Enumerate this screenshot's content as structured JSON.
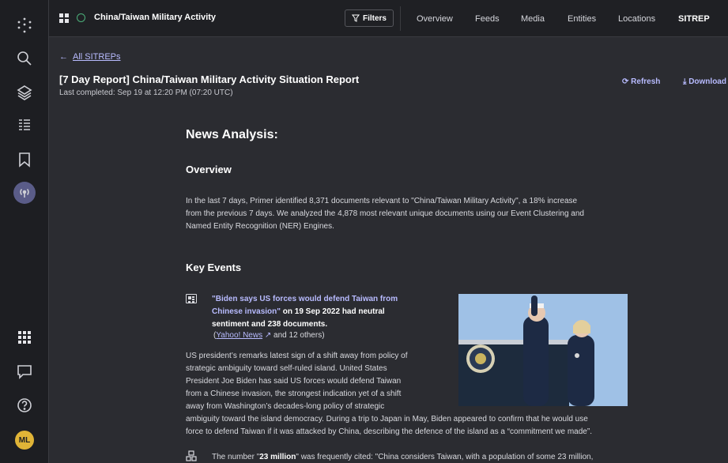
{
  "topbar": {
    "app_title": "China/Taiwan Military Activity",
    "filters_label": "Filters",
    "nav": [
      "Overview",
      "Feeds",
      "Media",
      "Entities",
      "Locations",
      "SITREP"
    ]
  },
  "rail": {
    "avatar_initials": "ML"
  },
  "header": {
    "back_label": "All SITREPs",
    "title": "[7 Day Report] China/Taiwan Military Activity Situation Report",
    "completed": "Last completed: Sep 19 at 12:20 PM (07:20 UTC)",
    "refresh_label": "Refresh",
    "download_label": "Download"
  },
  "content": {
    "heading": "News Analysis:",
    "overview_heading": "Overview",
    "overview_lines": [
      "In the last 7 days, Primer identified 8,371 documents relevant to \"China/Taiwan Military Activity\", a 18% increase",
      "from the previous 7 days. We analyzed the 4,878 most relevant unique documents using our Event Clustering and",
      "Named Entity Recognition (NER) Engines."
    ],
    "key_events_heading": "Key Events",
    "event": {
      "headline": "\"Biden says US forces would defend Taiwan from Chinese invasion\"",
      "headline_rest": " on 19 Sep 2022 had neutral sentiment and 238 documents.",
      "source_link": "Yahoo! News",
      "source_rest": " and 12 others)",
      "source_open": "(",
      "body_lines": [
        "US president’s remarks latest sign of a shift away from policy of",
        "strategic ambiguity toward self-ruled island. United States",
        "President Joe Biden has said US forces would defend Taiwan",
        "from a Chinese invasion, the strongest indication yet of a shift",
        "away from Washington’s decades-long policy of strategic",
        "ambiguity toward the island democracy. During a trip to Japan in May, Biden appeared to confirm that he would use",
        "force to defend Taiwan if it was attacked by China, describing the defence of the island as a “commitment we made”."
      ]
    },
    "citation": {
      "pre": "The number \"",
      "value": "23 million",
      "post": "\" was frequently cited: \"China considers Taiwan, with a population of some 23 million,"
    }
  }
}
